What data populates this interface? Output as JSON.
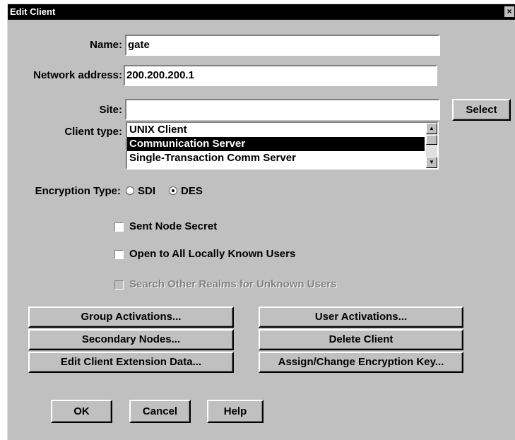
{
  "window": {
    "title": "Edit Client",
    "close_glyph": "×"
  },
  "fields": {
    "name": {
      "label": "Name:",
      "value": "gate"
    },
    "network_address": {
      "label": "Network address:",
      "value": "200.200.200.1"
    },
    "site": {
      "label": "Site:",
      "value": ""
    },
    "select_button": "Select"
  },
  "client_type": {
    "label": "Client type:",
    "items": [
      "UNIX Client",
      "Communication Server",
      "Single-Transaction Comm Server"
    ],
    "selected": "Communication Server"
  },
  "encryption": {
    "label": "Encryption Type:",
    "options": [
      {
        "label": "SDI",
        "checked": false
      },
      {
        "label": "DES",
        "checked": true
      }
    ]
  },
  "checkboxes": [
    {
      "label": "Sent Node Secret",
      "checked": false,
      "enabled": true
    },
    {
      "label": "Open to All Locally Known Users",
      "checked": false,
      "enabled": true
    },
    {
      "label": "Search Other Realms for Unknown Users",
      "checked": false,
      "enabled": false
    }
  ],
  "action_buttons": {
    "group_activations": "Group Activations...",
    "user_activations": "User Activations...",
    "secondary_nodes": "Secondary Nodes...",
    "delete_client": "Delete Client",
    "edit_extension": "Edit Client Extension Data...",
    "assign_key": "Assign/Change Encryption Key..."
  },
  "footer": {
    "ok": "OK",
    "cancel": "Cancel",
    "help": "Help"
  }
}
